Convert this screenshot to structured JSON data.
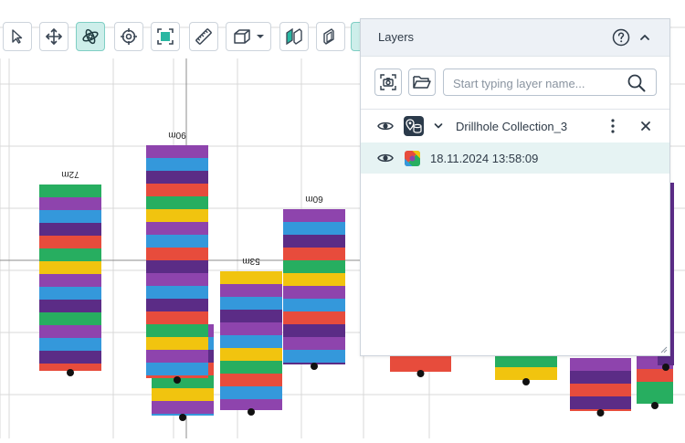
{
  "viewport": {
    "depth_labels": [
      "72m",
      "90m",
      "53m",
      "60m"
    ],
    "palette": {
      "green": "#27ae60",
      "purple": "#8e44ad",
      "blue": "#3498db",
      "dark_purple": "#5b2c86",
      "red": "#e74c3c",
      "yellow": "#f1c40f",
      "background": "#ffffff",
      "grid": "#d9d9d9"
    }
  },
  "toolbar": {
    "tools": [
      {
        "name": "select",
        "icon": "cursor-icon",
        "active": false
      },
      {
        "name": "move",
        "icon": "move-arrows-icon",
        "active": false
      },
      {
        "name": "rotate",
        "icon": "orbit-icon",
        "active": true
      },
      {
        "name": "target",
        "icon": "crosshair-icon",
        "active": false
      },
      {
        "name": "fit",
        "icon": "fit-frame-icon",
        "active": false
      },
      {
        "name": "measure",
        "icon": "ruler-icon",
        "active": false
      },
      {
        "name": "view-cube",
        "icon": "cube-dropdown-icon",
        "active": false
      },
      {
        "name": "section",
        "icon": "section-plane-icon",
        "active": false
      },
      {
        "name": "clip",
        "icon": "clip-plane-icon",
        "active": false
      }
    ],
    "active_color": "#cdeeea"
  },
  "layers_panel": {
    "title": "Layers",
    "search": {
      "placeholder": "Start typing layer name...",
      "value": ""
    },
    "collection": {
      "name": "Drillhole Collection_3",
      "visible": true,
      "expanded": true
    },
    "file": {
      "name": "18.11.2024 13:58:09",
      "visible": true
    },
    "selected_row_color": "#e6f3f3",
    "header_color": "#edf1f6"
  }
}
